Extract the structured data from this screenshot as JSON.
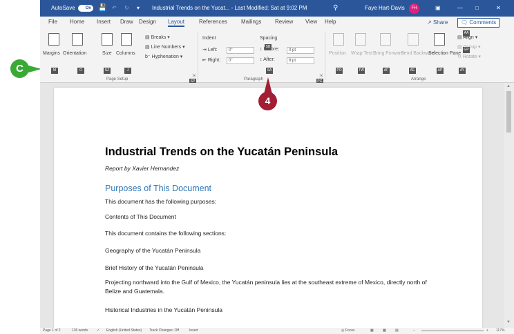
{
  "titlebar": {
    "autosave_label": "AutoSave",
    "autosave_state": "On",
    "doc_title": "Industrial Trends on the Yucat... - Last Modified: Sat at 9:02 PM",
    "user_name": "Faye Hart-Davis",
    "user_initials": "FH"
  },
  "tabs": [
    "File",
    "Home",
    "Insert",
    "Draw",
    "Design",
    "Layout",
    "References",
    "Mailings",
    "Review",
    "View",
    "Help"
  ],
  "active_tab": "Layout",
  "share_label": "Share",
  "comments_label": "Comments",
  "ribbon": {
    "page_setup": {
      "margins": "Margins",
      "orientation": "Orientation",
      "size": "Size",
      "columns": "Columns",
      "breaks": "Breaks",
      "line_numbers": "Line Numbers",
      "hyphenation": "Hyphenation",
      "group_label": "Page Setup"
    },
    "paragraph": {
      "indent_header": "Indent",
      "spacing_header": "Spacing",
      "left_label": "Left:",
      "left_value": "0\"",
      "right_label": "Right:",
      "right_value": "0\"",
      "before_label": "Before:",
      "before_value": "0 pt",
      "after_label": "After:",
      "after_value": "8 pt",
      "group_label": "Paragraph"
    },
    "arrange": {
      "position": "Position",
      "wrap_text": "Wrap Text",
      "bring_forward": "Bring Forward",
      "send_backward": "Send Backward",
      "selection_pane": "Selection Pane",
      "align": "Align",
      "group": "Group",
      "rotate": "Rotate",
      "group_label": "Arrange"
    },
    "keytips": [
      "M",
      "O",
      "SZ",
      "J",
      "SP",
      "SB",
      "SA",
      "PG",
      "PO",
      "TW",
      "AF",
      "AE",
      "AP",
      "AY",
      "AA",
      "GP"
    ]
  },
  "document": {
    "title": "Industrial Trends on the Yucatán Peninsula",
    "subtitle": "Report by Xavier Hernandez",
    "heading": "Purposes of This Document",
    "paragraphs": [
      "This document has the following purposes:",
      "Contents of This Document",
      "This document contains the following sections:",
      "Geography of the Yucatán Peninsula",
      "Brief History of the Yucatán Peninsula",
      "Projecting northward into the Gulf of Mexico, the Yucatán peninsula lies at the southeast extreme of Mexico, directly north of Belize and Guatemala.",
      "Historical Industries in the Yucatán Peninsula"
    ]
  },
  "statusbar": {
    "page": "Page 1 of 2",
    "words": "136 words",
    "language": "English (United States)",
    "track_changes": "Track Changes: Off",
    "insert": "Insert",
    "focus": "Focus",
    "zoom": "117%"
  },
  "callouts": {
    "letter": "C",
    "step": "4"
  },
  "colors": {
    "title_bar": "#2b579a",
    "heading_blue": "#2e74b5",
    "callout_green": "#3aaa35",
    "callout_red": "#a31d34"
  }
}
